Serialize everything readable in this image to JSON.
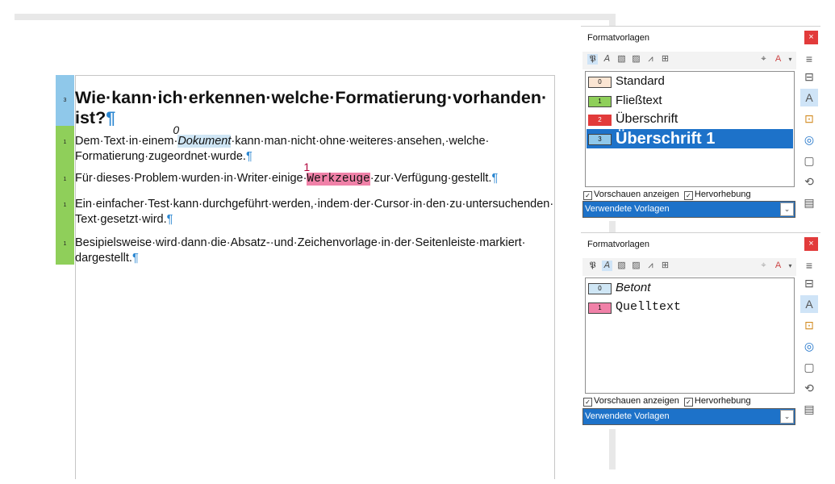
{
  "document": {
    "heading": {
      "text": "Wie·kann·ich·erkennen·welche·Formatierung·vorhanden·",
      "text2": "ist?",
      "mark": "¶",
      "level": "3"
    },
    "p1": {
      "pre": "Dem·Text·in·einem·",
      "em": "Dokument",
      "em_number": "0",
      "post": "·kann·man·nicht·ohne·weiteres·ansehen,·welche·",
      "line2": "Formatierung·zugeordnet·wurde.",
      "mark": "¶",
      "level": "1"
    },
    "p2": {
      "pre": "Für·dieses·Problem·wurden·in·Writer·einige·",
      "code": "Werkzeuge",
      "code_number": "1",
      "post": "·zur·Verfügung·gestellt.",
      "mark": "¶",
      "level": "1"
    },
    "p3": {
      "line1": "Ein·einfacher·Test·kann·durchgeführt·werden,·indem·der·Cursor·in·den·zu·untersuchenden·",
      "line2": "Text·gesetzt·wird.",
      "mark": "¶",
      "level": "1"
    },
    "p4": {
      "line1": "Besipielsweise·wird·dann·die·Absatz-·und·Zeichenvorlage·in·der·Seitenleiste·markiert·",
      "line2": "dargestellt.",
      "mark": "¶",
      "level": "1"
    },
    "colors": {
      "heading_bar": "#8fc8ea",
      "body_bar": "#8fcf5a",
      "emph_bg": "#cfe6f5",
      "code_bg": "#f081a8",
      "pilcrow": "#2a86d1"
    }
  },
  "panel1": {
    "title": "Formatvorlagen",
    "close": "×",
    "toolbar_icons": [
      "paragraph-styles-icon",
      "character-styles-icon",
      "frame-styles-icon",
      "page-styles-icon",
      "list-styles-icon",
      "table-styles-icon",
      "fill-format-icon",
      "new-style-icon"
    ],
    "toolbar_glyphs": [
      "𝕻",
      "𝘈",
      "▧",
      "▨",
      "⩘",
      "⊞",
      "⌖",
      "A"
    ],
    "items": [
      {
        "number": "0",
        "label": "Standard",
        "color": "#fbe5d3"
      },
      {
        "number": "1",
        "label": "Fließtext",
        "color": "#8fcf5a"
      },
      {
        "number": "2",
        "label": "Überschrift",
        "color": "#e23b3b"
      },
      {
        "number": "3",
        "label": "Überschrift 1",
        "color": "#8fc8ea"
      }
    ],
    "preview_label": "Vorschauen anzeigen",
    "highlight_label": "Hervorhebung",
    "check": "✓",
    "filter_value": "Verwendete Vorlagen",
    "arrow": "⌄"
  },
  "panel2": {
    "title": "Formatvorlagen",
    "close": "×",
    "items": [
      {
        "number": "0",
        "label": "Betont",
        "color": "#cfe6f5"
      },
      {
        "number": "1",
        "label": "Quelltext",
        "color": "#f081a8"
      }
    ],
    "preview_label": "Vorschauen anzeigen",
    "highlight_label": "Hervorhebung",
    "check": "✓",
    "filter_value": "Verwendete Vorlagen",
    "arrow": "⌄"
  },
  "deck": {
    "glyphs": [
      "≡",
      "⊟",
      "A",
      "⊡",
      "◎",
      "▢",
      "⟲",
      "▤"
    ],
    "icons": [
      "menu-icon",
      "properties-icon",
      "styles-icon",
      "gallery-icon",
      "navigator-icon",
      "page-icon",
      "style-inspector-icon",
      "manage-changes-icon"
    ]
  }
}
